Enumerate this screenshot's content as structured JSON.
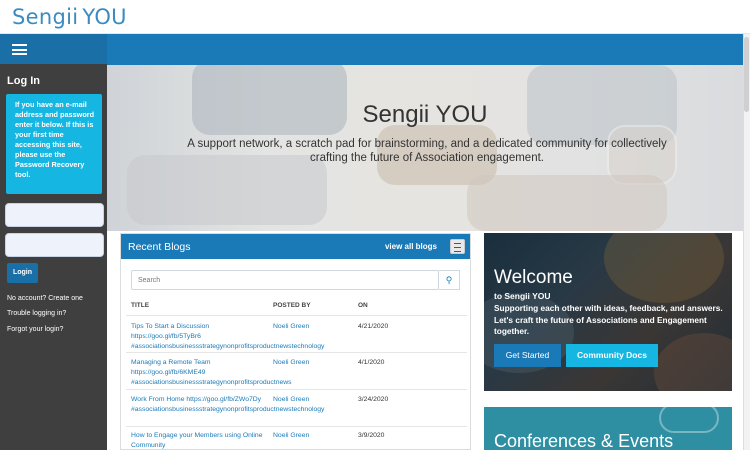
{
  "brand": {
    "name": "Sengii",
    "suffix": "YOU"
  },
  "sidebar": {
    "login_title": "Log In",
    "login_info": "If you have an e-mail address and password enter it below. If this is your first time accessing this site, please use the Password Recovery tool.",
    "login_button": "Login",
    "links": [
      "No account? Create one",
      "Trouble logging in?",
      "Forgot your login?"
    ]
  },
  "hero": {
    "title": "Sengii YOU",
    "subtitle": "A support network, a scratch pad for brainstorming, and a dedicated community for collectively crafting the future of Association engagement."
  },
  "blogs": {
    "title": "Recent Blogs",
    "view_all": "view all blogs",
    "search_placeholder": "Search",
    "columns": [
      "TITLE",
      "POSTED BY",
      "ON"
    ],
    "rows": [
      {
        "title": "Tips To Start a Discussion https://goo.gl/fb/5TyBr6 #associationsbusinessstrategynonprofitsproductnewstechnology",
        "author": "Noeli Green",
        "date": "4/21/2020"
      },
      {
        "title": "Managing a Remote Team https://goo.gl/fb/6KME49 #associationsbusinessstrategynonprofitsproductnews",
        "author": "Noeli Green",
        "date": "4/1/2020"
      },
      {
        "title": "Work From Home https://goo.gl/fb/ZWo7Dy #associationsbusinessstrategynonprofitsproductnewstechnology",
        "author": "Noeli Green",
        "date": "3/24/2020"
      },
      {
        "title": "How to Engage your Members using Online Community",
        "author": "Noeli Green",
        "date": "3/9/2020"
      }
    ]
  },
  "welcome": {
    "title": "Welcome",
    "subtitle": "to Sengii YOU",
    "text": "Supporting each other with ideas, feedback, and answers. Let's craft the future of Associations and Engagement together.",
    "btn_get_started": "Get Started",
    "btn_docs": "Community Docs"
  },
  "conferences": {
    "title": "Conferences & Events"
  },
  "colors": {
    "primary": "#1a7ab8",
    "accent": "#15b6e2",
    "sidebar": "#3f3f3f"
  }
}
